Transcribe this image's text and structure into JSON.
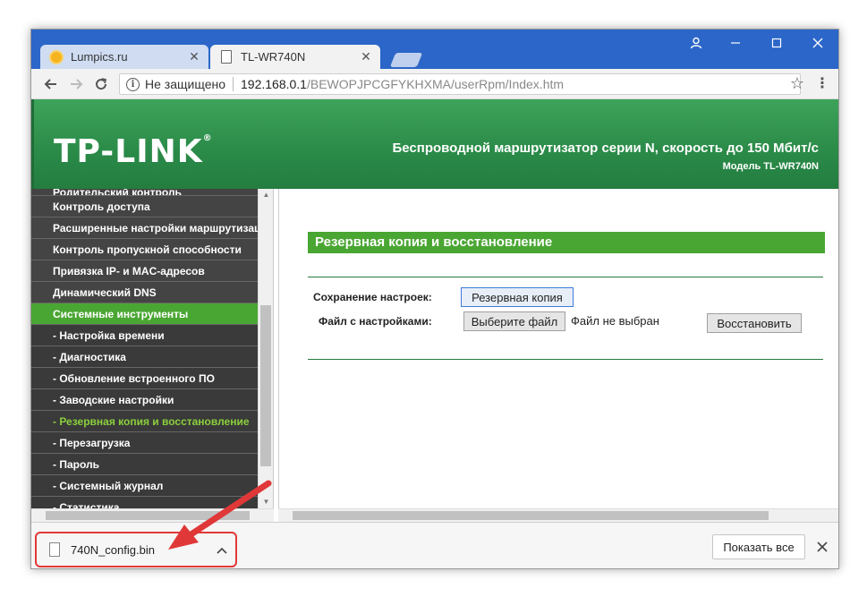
{
  "browser": {
    "tabs": [
      {
        "label": "Lumpics.ru",
        "icon": "lumpics-favicon-icon"
      },
      {
        "label": "TL-WR740N",
        "icon": "page-icon"
      }
    ],
    "window_controls": {
      "user": "user-icon",
      "minimize": "minimize-icon",
      "maximize": "maximize-icon",
      "close": "close-icon"
    },
    "address": {
      "security_label": "Не защищено",
      "host": "192.168.0.1",
      "path": "/BEWOPJPCGFYKHXMA/userRpm/Index.htm"
    }
  },
  "router": {
    "logo": "TP-LINK",
    "header_title": "Беспроводной маршрутизатор серии N, скорость до 150 Мбит/с",
    "model": "Модель TL-WR740N",
    "menu": [
      {
        "label": "Родительский контроль",
        "type": "cut"
      },
      {
        "label": "Контроль доступа",
        "type": "main"
      },
      {
        "label": "Расширенные настройки маршрутизации",
        "type": "main"
      },
      {
        "label": "Контроль пропускной способности",
        "type": "main"
      },
      {
        "label": "Привязка IP- и MAC-адресов",
        "type": "main"
      },
      {
        "label": "Динамический DNS",
        "type": "main"
      },
      {
        "label": "Системные инструменты",
        "type": "active"
      },
      {
        "label": "- Настройка времени",
        "type": "sub"
      },
      {
        "label": "- Диагностика",
        "type": "sub"
      },
      {
        "label": "- Обновление встроенного ПО",
        "type": "sub"
      },
      {
        "label": "- Заводские настройки",
        "type": "sub"
      },
      {
        "label": "- Резервная копия и восстановление",
        "type": "current"
      },
      {
        "label": "- Перезагрузка",
        "type": "sub"
      },
      {
        "label": "- Пароль",
        "type": "sub"
      },
      {
        "label": "- Системный журнал",
        "type": "sub"
      },
      {
        "label": "- Статистика",
        "type": "sub"
      }
    ],
    "section": {
      "title": "Резервная копия и восстановление",
      "save_label": "Сохранение настроек:",
      "backup_button": "Резервная копия",
      "file_label": "Файл с настройками:",
      "choose_file_button": "Выберите файл",
      "no_file": "Файл не выбран",
      "restore_button": "Восстановить"
    }
  },
  "downloads": {
    "file_name": "740N_config.bin",
    "show_all": "Показать все"
  },
  "colors": {
    "titlebar": "#2b66c8",
    "router_green": "#4aa633",
    "menu_dark": "#444444",
    "highlight": "#e03838"
  }
}
